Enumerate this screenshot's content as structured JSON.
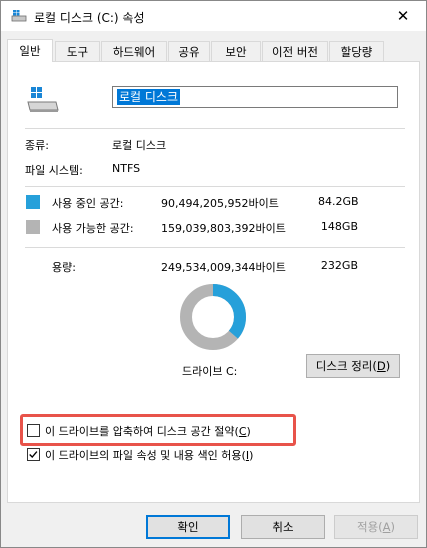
{
  "window": {
    "title": "로컬 디스크 (C:) 속성",
    "close_glyph": "✕"
  },
  "tabs": [
    {
      "label": "일반",
      "active": true
    },
    {
      "label": "도구"
    },
    {
      "label": "하드웨어"
    },
    {
      "label": "공유"
    },
    {
      "label": "보안"
    },
    {
      "label": "이전 버전"
    },
    {
      "label": "할당량"
    }
  ],
  "general": {
    "drive_name": "로컬 디스크",
    "type_label": "종류:",
    "type_value": "로컬 디스크",
    "fs_label": "파일 시스템:",
    "fs_value": "NTFS",
    "used": {
      "label": "사용 중인 공간:",
      "bytes": "90,494,205,952바이트",
      "size": "84.2GB",
      "color": "#26a0da"
    },
    "free": {
      "label": "사용 가능한 공간:",
      "bytes": "159,039,803,392바이트",
      "size": "148GB",
      "color": "#b4b4b4"
    },
    "capacity": {
      "label": "용량:",
      "bytes": "249,534,009,344바이트",
      "size": "232GB"
    },
    "used_fraction": 0.363,
    "drive_label": "드라이브 C:",
    "cleanup_button": {
      "text": "디스크 정리(",
      "key": "D",
      "end": ")"
    },
    "compress_checkbox": {
      "text": "이 드라이브를 압축하여 디스크 공간 절약(",
      "key": "C",
      "end": ")",
      "checked": false
    },
    "index_checkbox": {
      "text": "이 드라이브의 파일 속성 및 내용 색인 허용(",
      "key": "I",
      "end": ")",
      "checked": true
    }
  },
  "buttons": {
    "ok": "확인",
    "cancel": "취소",
    "apply": {
      "text": "적용(",
      "key": "A",
      "end": ")"
    }
  }
}
